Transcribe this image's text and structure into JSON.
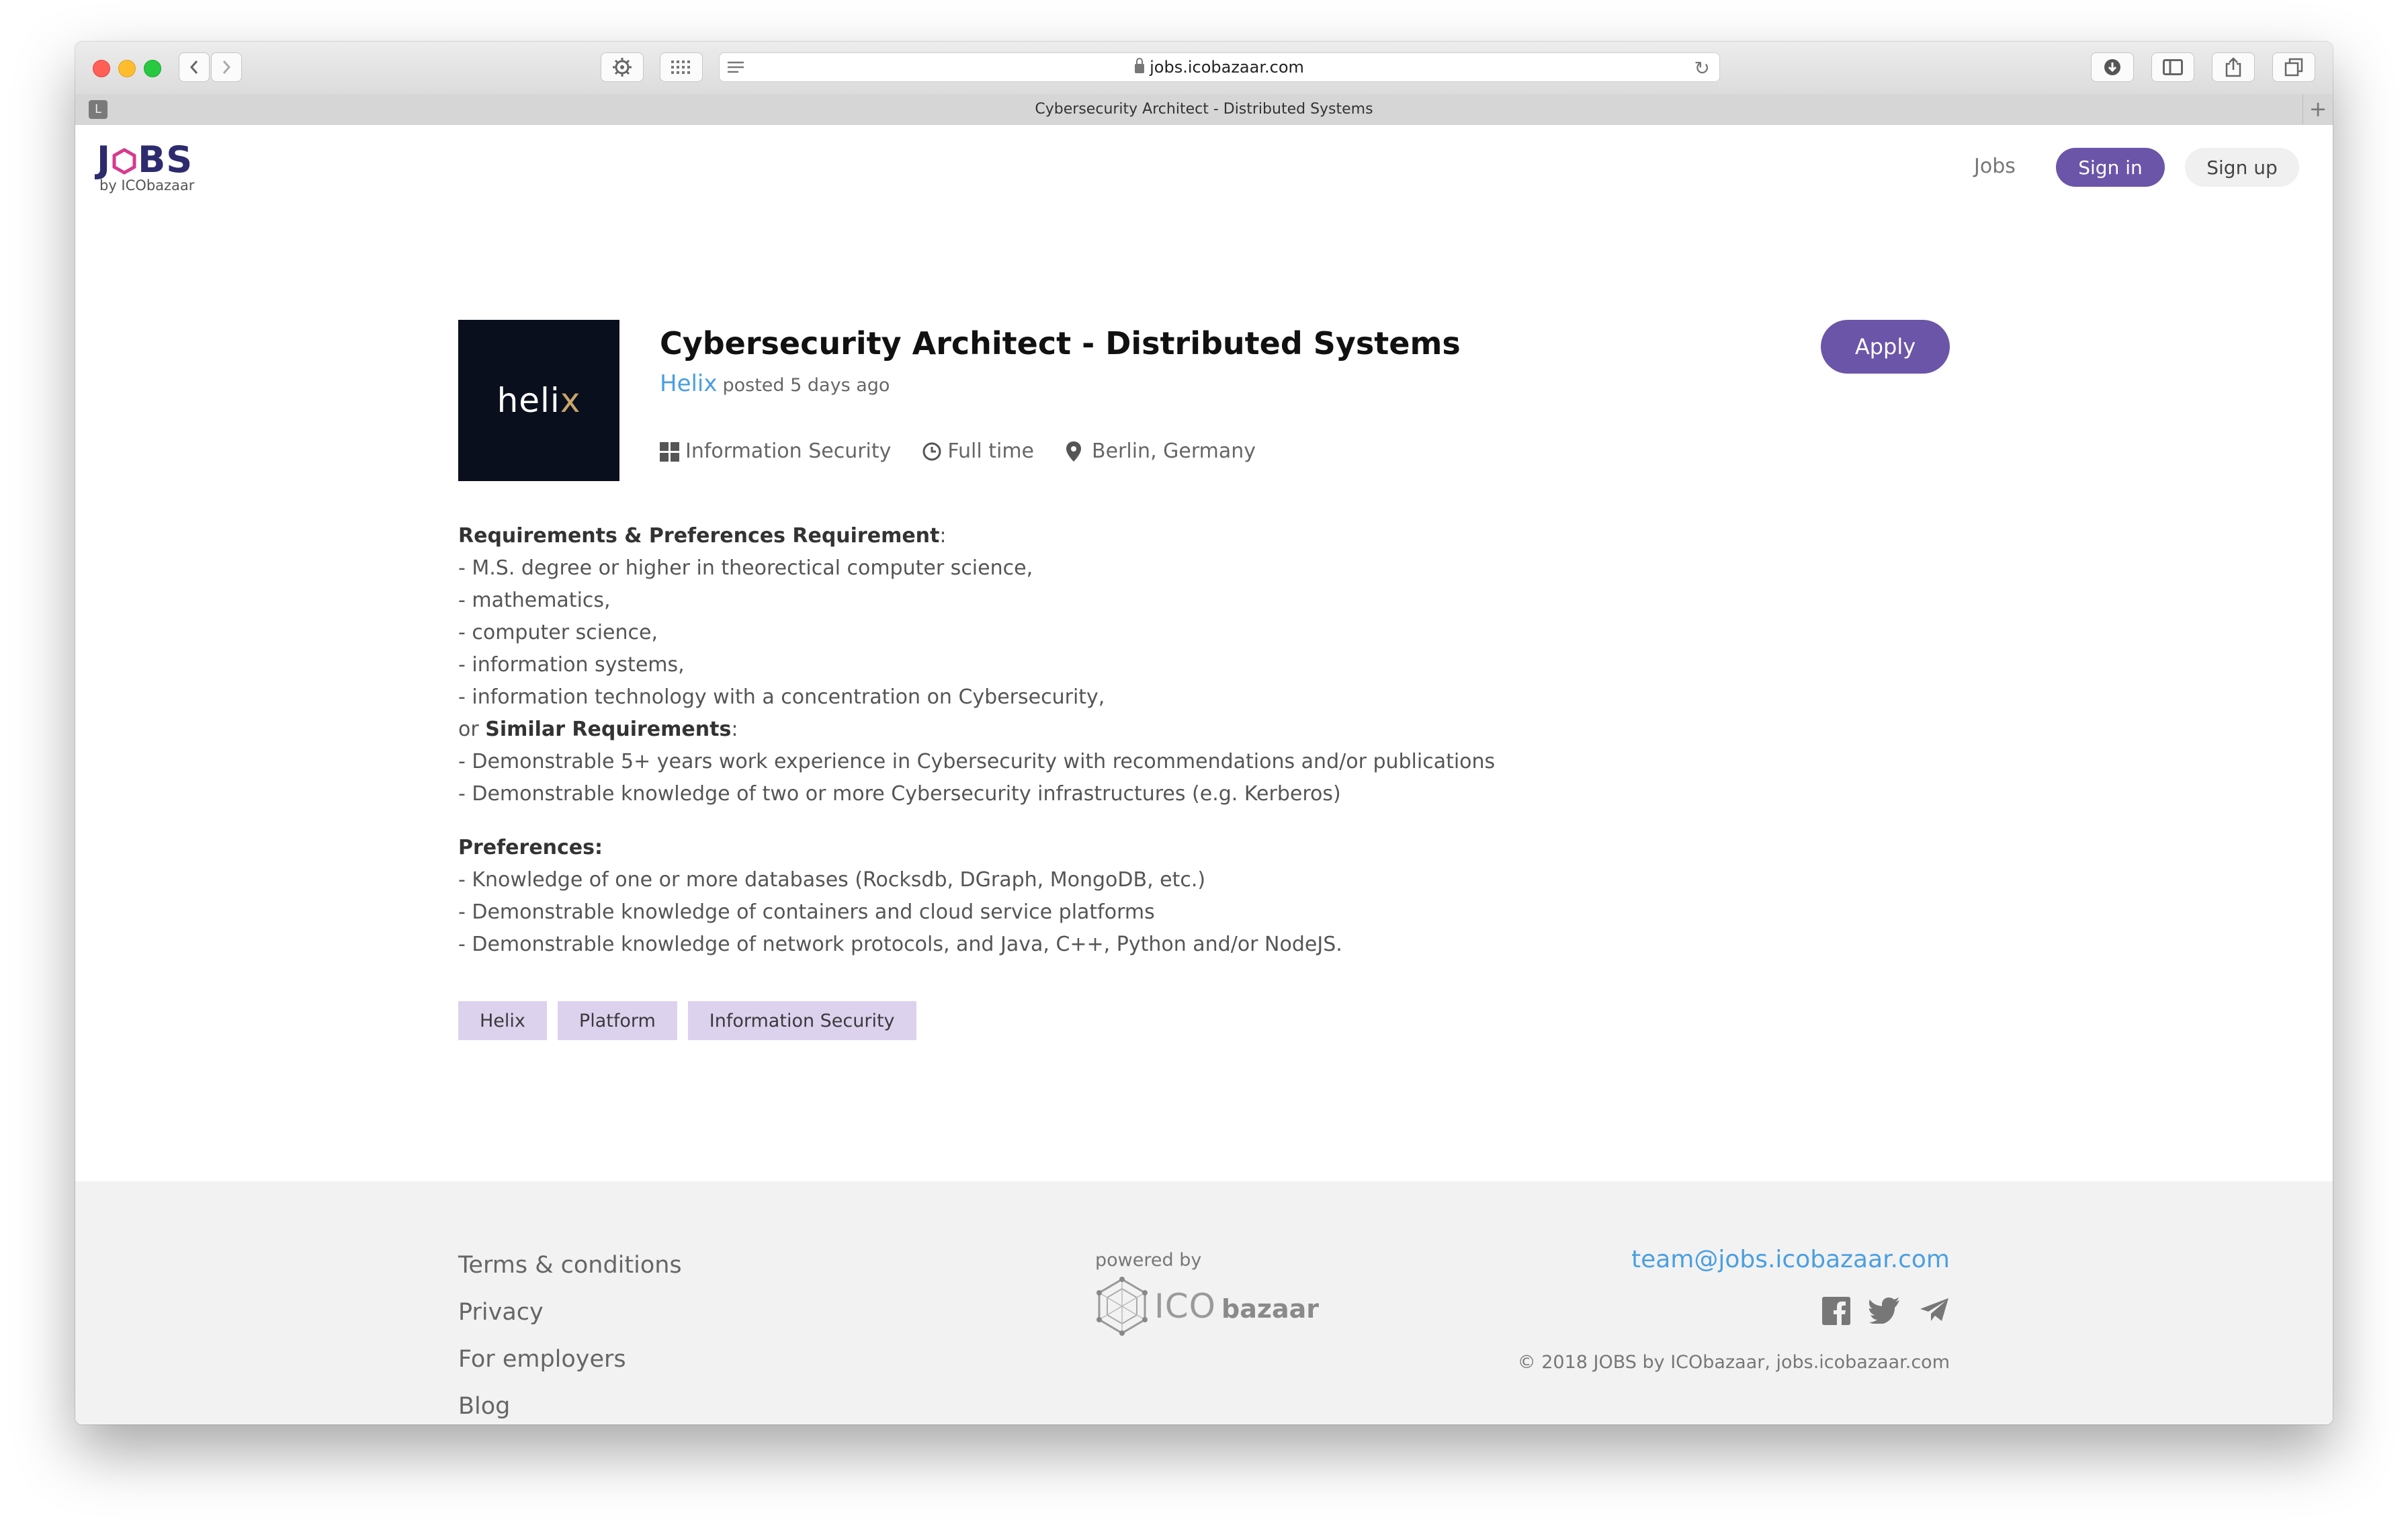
{
  "browser": {
    "url": "jobs.icobazaar.com",
    "tab_title": "Cybersecurity Architect - Distributed Systems",
    "tab_icon_letter": "L"
  },
  "header": {
    "logo_text_left": "J",
    "logo_text_right": "BS",
    "logo_sub": "by ICObazaar",
    "nav_jobs": "Jobs",
    "sign_in": "Sign in",
    "sign_up": "Sign up"
  },
  "job": {
    "company_logo_text_main": "heli",
    "company_logo_text_accent": "x",
    "title": "Cybersecurity Architect - Distributed Systems",
    "company": "Helix",
    "posted": "posted 5 days ago",
    "apply": "Apply",
    "category": "Information Security",
    "type": "Full time",
    "location": "Berlin, Germany"
  },
  "description": {
    "req_heading": "Requirements & Preferences Requirement",
    "req_heading_colon": ":",
    "req_items": [
      "- M.S. degree or higher in theorectical computer science,",
      "- mathematics,",
      "- computer science,",
      "- information systems,",
      "- information technology with a concentration on Cybersecurity,"
    ],
    "or_prefix": "or ",
    "similar_heading": "Similar Requirements",
    "similar_colon": ":",
    "similar_items": [
      "- Demonstrable 5+ years work experience in Cybersecurity with recommendations and/or publications",
      "- Demonstrable knowledge of two or more Cybersecurity infrastructures (e.g. Kerberos)"
    ],
    "pref_heading": "Preferences:",
    "pref_items": [
      "- Knowledge of one or more databases (Rocksdb, DGraph, MongoDB, etc.)",
      "- Demonstrable knowledge of containers and cloud service platforms",
      "- Demonstrable knowledge of network protocols, and Java, C++, Python and/or NodeJS."
    ]
  },
  "tags": [
    "Helix",
    "Platform",
    "Information Security"
  ],
  "footer": {
    "links": [
      "Terms & conditions",
      "Privacy",
      "For employers",
      "Blog"
    ],
    "powered_by": "powered by",
    "ico_text": "ICO",
    "bazaar_text": "bazaar",
    "email": "team@jobs.icobazaar.com",
    "copyright": "© 2018 JOBS by ICObazaar, jobs.icobazaar.com"
  },
  "colors": {
    "brand_purple": "#6b55a8",
    "link_blue": "#4a9fe0",
    "tag_bg": "#dcd2ee"
  },
  "icons": [
    "lock-icon",
    "reload-icon",
    "grid-icon",
    "clock-icon",
    "location-pin-icon",
    "facebook-icon",
    "twitter-icon",
    "telegram-icon"
  ]
}
